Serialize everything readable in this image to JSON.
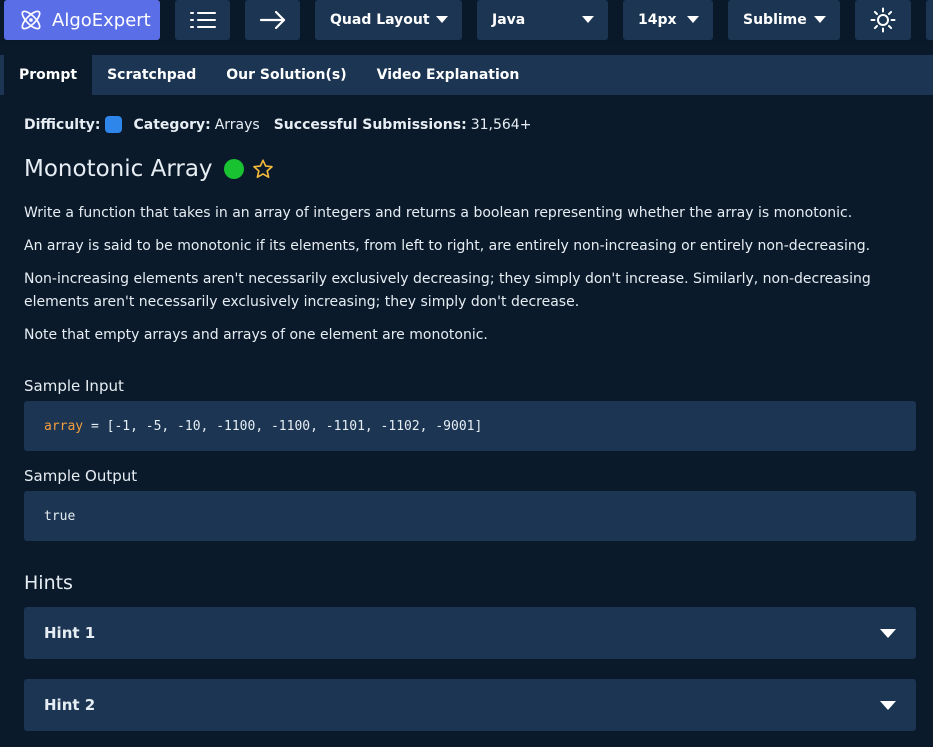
{
  "toolbar": {
    "logo_label": "AlgoExpert",
    "layout_label": "Quad Layout",
    "language_label": "Java",
    "font_size_label": "14px",
    "keymap_label": "Sublime"
  },
  "tabs": [
    {
      "label": "Prompt",
      "active": true
    },
    {
      "label": "Scratchpad",
      "active": false
    },
    {
      "label": "Our Solution(s)",
      "active": false
    },
    {
      "label": "Video Explanation",
      "active": false
    }
  ],
  "meta": {
    "difficulty_label": "Difficulty:",
    "category_label": "Category:",
    "category_value": "Arrays",
    "submissions_label": "Successful Submissions:",
    "submissions_value": "31,564+"
  },
  "problem": {
    "title": "Monotonic Array",
    "paragraphs": [
      "Write a function that takes in an array of integers and returns a boolean representing whether the array is monotonic.",
      "An array is said to be monotonic if its elements, from left to right, are entirely non-increasing or entirely non-decreasing.",
      "Non-increasing elements aren't necessarily exclusively decreasing; they simply don't increase. Similarly, non-decreasing elements aren't necessarily exclusively increasing; they simply don't decrease.",
      "Note that empty arrays and arrays of one element are monotonic."
    ]
  },
  "sample_input": {
    "heading": "Sample Input",
    "var_name": "array",
    "code_rest": " = [-1, -5, -10, -1100, -1100, -1101, -1102, -9001]"
  },
  "sample_output": {
    "heading": "Sample Output",
    "code": "true"
  },
  "hints": {
    "heading": "Hints",
    "items": [
      "Hint 1",
      "Hint 2"
    ]
  },
  "colors": {
    "background": "#0b1a2b",
    "panel": "#1b3552",
    "accent": "#5a6ee8",
    "difficulty": "#2f86ea",
    "completed": "#19c231",
    "star": "#f5b93a",
    "code_keyword": "#f39c3d"
  }
}
